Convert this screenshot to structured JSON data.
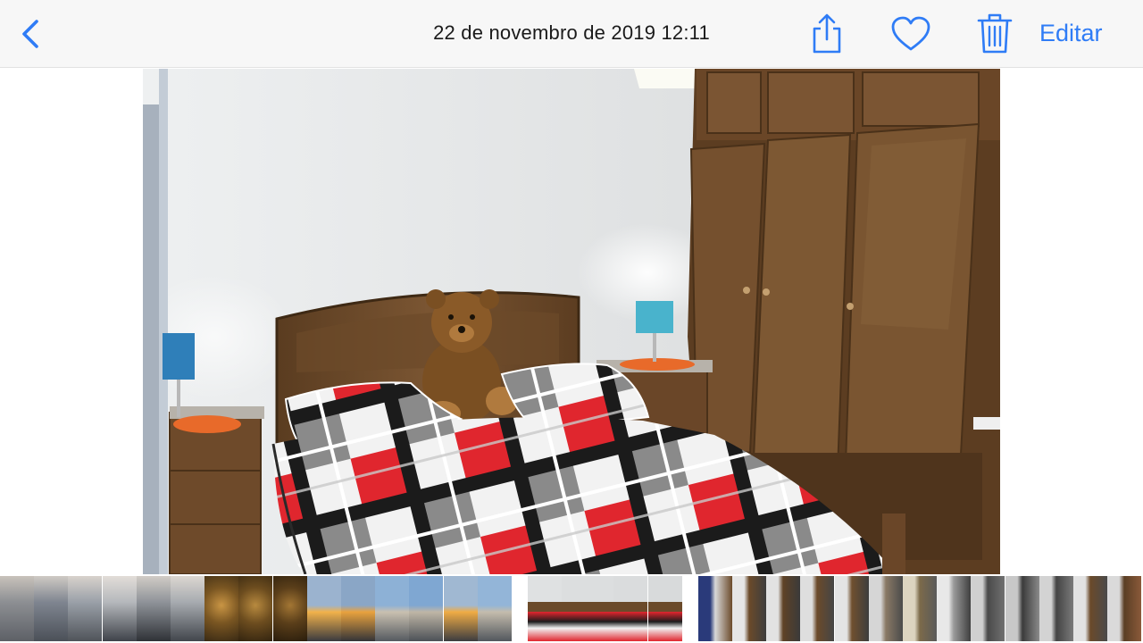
{
  "navbar": {
    "back_icon": "chevron-left-icon",
    "title": "22 de novembro de 2019  12:11",
    "share_icon": "share-icon",
    "favorite_icon": "heart-icon",
    "delete_icon": "trash-icon",
    "edit_label": "Editar",
    "accent_color": "#2f7cf6"
  },
  "photo": {
    "subject": "bedroom",
    "colors": {
      "wall": "#dfe1e2",
      "wood": "#6b4a2a",
      "blanket_red": "#e0262e",
      "blanket_black": "#1b1b1b",
      "blanket_grey": "#8a8a8a"
    }
  },
  "filmstrip": {
    "thumbnails": [
      {
        "kind": "crowd",
        "colors": [
          "#8d8f93",
          "#5d6066",
          "#c8c2bb"
        ]
      },
      {
        "kind": "crowd",
        "colors": [
          "#7f8590",
          "#4b5058",
          "#cfcac4"
        ]
      },
      {
        "kind": "crowd",
        "colors": [
          "#9aa0a8",
          "#50545a",
          "#d8d2cc"
        ]
      },
      {
        "kind": "crowd",
        "colors": [
          "#b5b8bc",
          "#3f434a",
          "#e2ddd8"
        ]
      },
      {
        "kind": "crowd",
        "colors": [
          "#8f9399",
          "#2f3237",
          "#d1ccc6"
        ]
      },
      {
        "kind": "crowd",
        "colors": [
          "#a7abb0",
          "#42464c",
          "#dcd7d1"
        ]
      },
      {
        "kind": "gold",
        "colors": [
          "#7a5622",
          "#c99544",
          "#3a2a14"
        ]
      },
      {
        "kind": "gold",
        "colors": [
          "#6d4d1f",
          "#b88a3f",
          "#33240f"
        ]
      },
      {
        "kind": "gold",
        "colors": [
          "#5b3f1a",
          "#a37634",
          "#2a1d0c"
        ]
      },
      {
        "kind": "sunset",
        "colors": [
          "#9bb3cf",
          "#f2b24b",
          "#3a3a3f"
        ]
      },
      {
        "kind": "sunset",
        "colors": [
          "#8aa6c6",
          "#e9a23e",
          "#343438"
        ]
      },
      {
        "kind": "beach",
        "colors": [
          "#8db1d6",
          "#c9c0b0",
          "#555a60"
        ]
      },
      {
        "kind": "beach",
        "colors": [
          "#7fa7d2",
          "#bfb6a6",
          "#4c5157"
        ]
      },
      {
        "kind": "sunset",
        "colors": [
          "#a0b8d2",
          "#f0ac45",
          "#3c3c40"
        ]
      },
      {
        "kind": "beach",
        "colors": [
          "#93b5d8",
          "#c4bcad",
          "#52575d"
        ]
      },
      {
        "kind": "bed",
        "colors": [
          "#dfe1e2",
          "#6b4a2a",
          "#e0262e"
        ]
      },
      {
        "kind": "bed",
        "colors": [
          "#dcdedf",
          "#6b4a2a",
          "#e0262e"
        ]
      },
      {
        "kind": "bed",
        "colors": [
          "#dadcdd",
          "#6b4a2a",
          "#e0262e"
        ]
      },
      {
        "kind": "bed",
        "colors": [
          "#d8dadb",
          "#6b4a2a",
          "#e0262e"
        ]
      },
      {
        "kind": "room",
        "colors": [
          "#2a3a7a",
          "#d9d9d9",
          "#6b4a2a"
        ]
      },
      {
        "kind": "room",
        "colors": [
          "#e6e6e6",
          "#6b4a2a",
          "#3d3d3d"
        ]
      },
      {
        "kind": "room",
        "colors": [
          "#e2e2e2",
          "#5f4226",
          "#3a3a3a"
        ]
      },
      {
        "kind": "room",
        "colors": [
          "#dedede",
          "#6b4a2a",
          "#454545"
        ]
      },
      {
        "kind": "room",
        "colors": [
          "#e4e4e4",
          "#70502f",
          "#3d3d3d"
        ]
      },
      {
        "kind": "room",
        "colors": [
          "#d6d6d6",
          "#8a7a66",
          "#4a4a4a"
        ]
      },
      {
        "kind": "room",
        "colors": [
          "#dcd4c0",
          "#7c6a4a",
          "#5a5a5a"
        ]
      },
      {
        "kind": "room",
        "colors": [
          "#e8e8e8",
          "#9a9a9a",
          "#3f3f3f"
        ]
      },
      {
        "kind": "room",
        "colors": [
          "#d0d0d0",
          "#4a4a4a",
          "#707070"
        ]
      },
      {
        "kind": "room",
        "colors": [
          "#c8c8c8",
          "#3b3b3b",
          "#8a8a8a"
        ]
      },
      {
        "kind": "room",
        "colors": [
          "#d3d3d3",
          "#444444",
          "#7a7a7a"
        ]
      },
      {
        "kind": "room",
        "colors": [
          "#e2e2e2",
          "#6b4a2a",
          "#4a4a4a"
        ]
      },
      {
        "kind": "room",
        "colors": [
          "#dadada",
          "#5a3e24",
          "#8a5a3a"
        ]
      }
    ]
  }
}
